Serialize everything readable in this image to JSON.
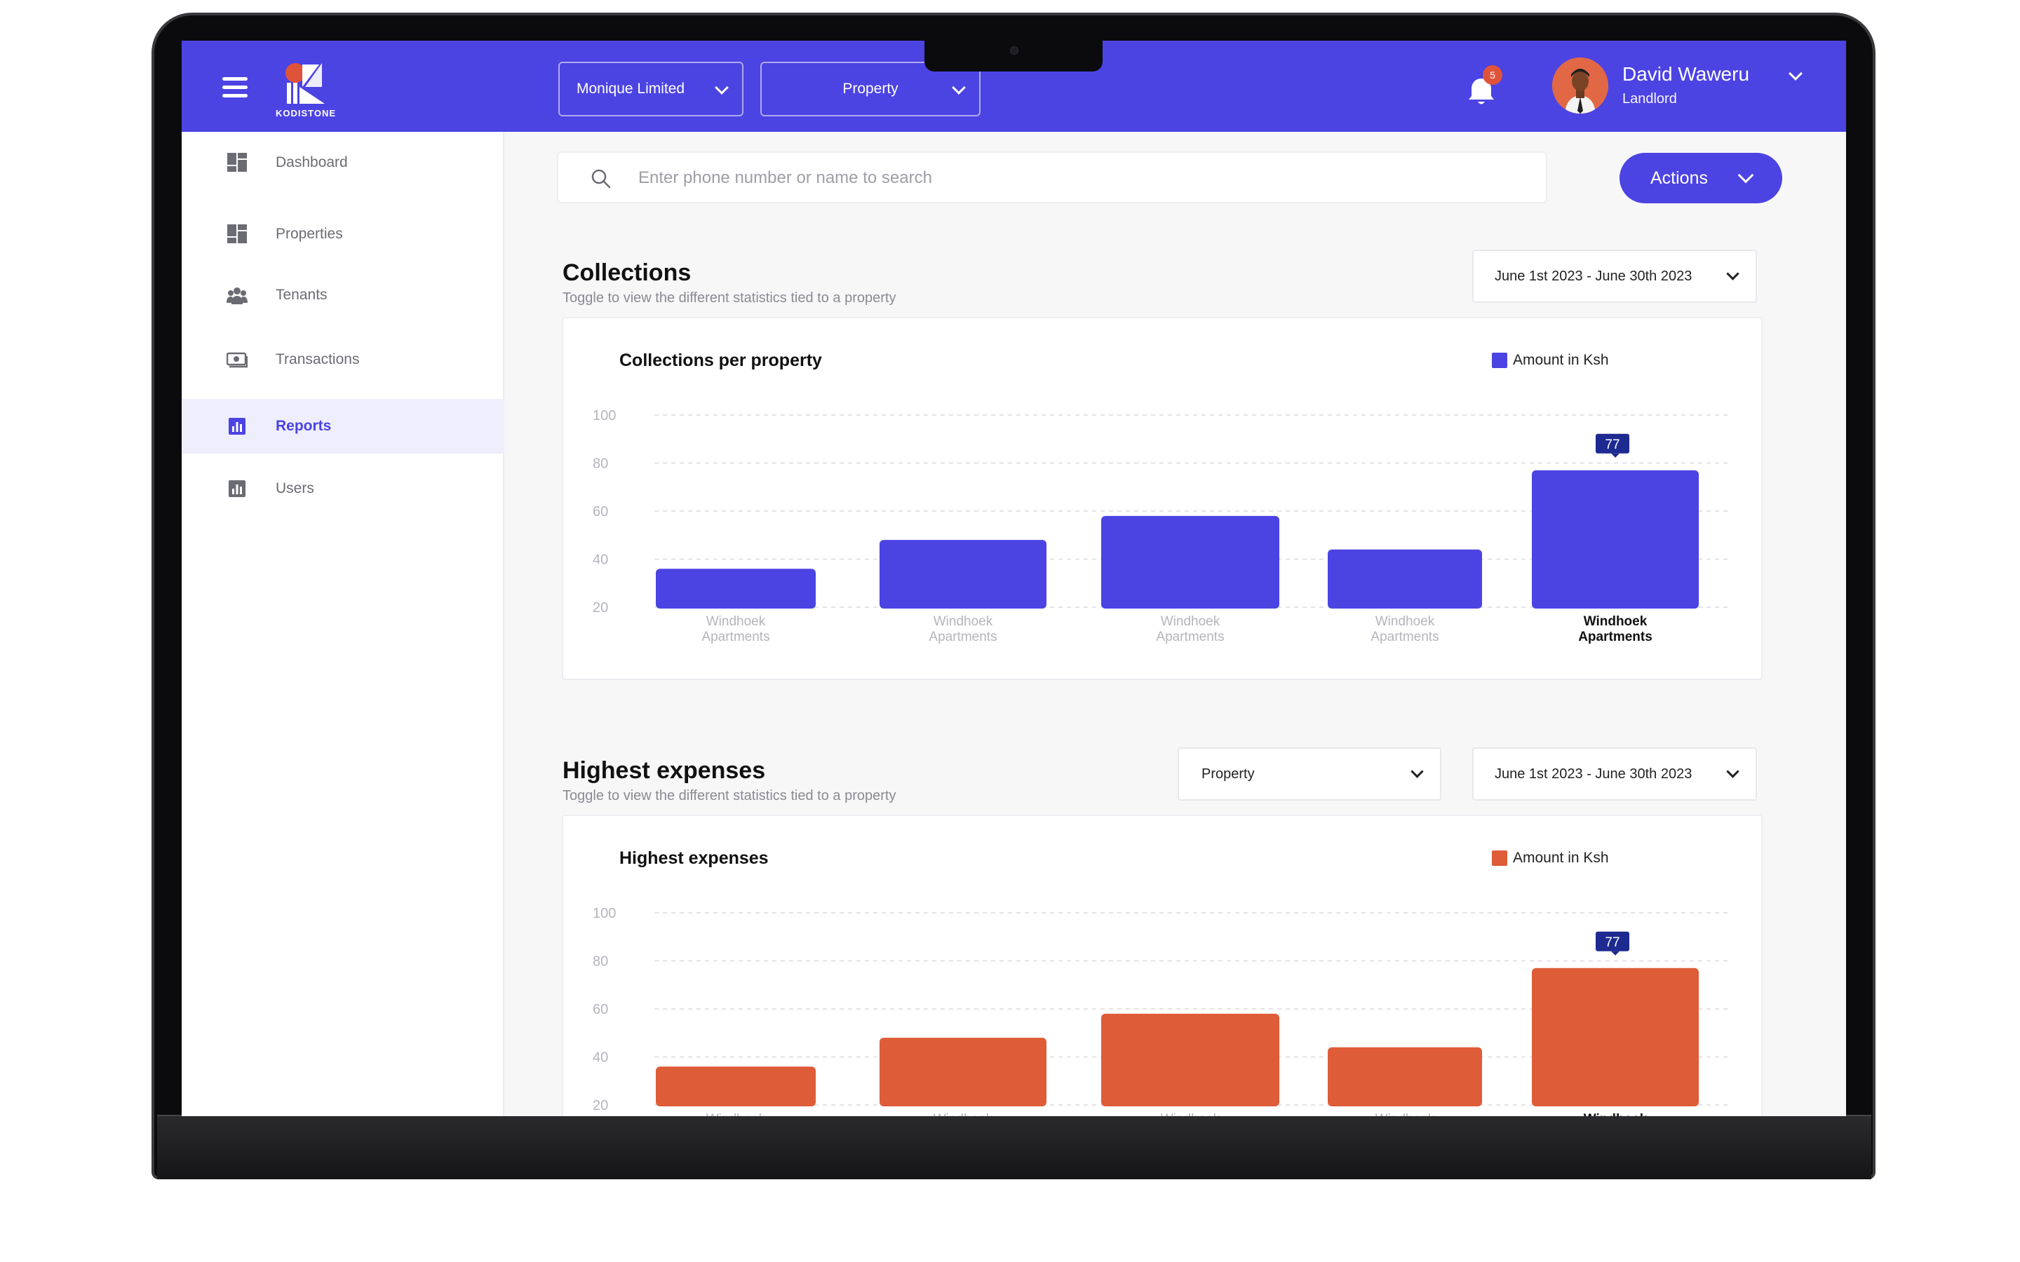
{
  "header": {
    "app_name": "KODISTONE",
    "company_select": "Monique Limited",
    "property_select": "Property",
    "notifications_count": "5",
    "user_name": "David Waweru",
    "user_role": "Landlord"
  },
  "sidebar": {
    "items": [
      {
        "label": "Dashboard",
        "icon": "dashboard-icon"
      },
      {
        "label": "Properties",
        "icon": "dashboard-icon"
      },
      {
        "label": "Tenants",
        "icon": "users-group-icon"
      },
      {
        "label": "Transactions",
        "icon": "cash-icon"
      },
      {
        "label": "Reports",
        "icon": "bar-chart-icon",
        "active": true
      },
      {
        "label": "Users",
        "icon": "bar-chart-icon"
      }
    ]
  },
  "search": {
    "placeholder": "Enter phone number or name to search"
  },
  "actions_label": "Actions",
  "collections": {
    "title": "Collections",
    "subtitle": "Toggle to view the different statistics tied to a property",
    "date_range": "June 1st 2023 - June 30th 2023",
    "card_title": "Collections per property",
    "legend": "Amount in Ksh",
    "color": "#4c43e3"
  },
  "expenses": {
    "title": "Highest expenses",
    "subtitle": "Toggle to view the different statistics tied to a property",
    "property_select": "Property",
    "date_range": "June 1st 2023 - June 30th 2023",
    "card_title": "Highest expenses",
    "legend": "Amount in Ksh",
    "color": "#de5c38"
  },
  "chart_data": [
    {
      "type": "bar",
      "title": "Collections per property",
      "categories": [
        "Windhoek Apartments",
        "Windhoek Apartments",
        "Windhoek Apartments",
        "Windhoek Apartments",
        "Windhoek Apartments"
      ],
      "series": [
        {
          "name": "Amount in Ksh",
          "values": [
            36,
            48,
            58,
            44,
            77
          ]
        }
      ],
      "y_ticks": [
        100,
        80,
        60,
        40,
        20
      ],
      "ylim": [
        20,
        100
      ],
      "highlight_index": 4,
      "highlight_label": "77",
      "legend_position": "top-right",
      "grid": true
    },
    {
      "type": "bar",
      "title": "Highest expenses",
      "categories": [
        "Windhoek Apartments",
        "Windhoek Apartments",
        "Windhoek Apartments",
        "Windhoek Apartments",
        "Windhoek Apartments"
      ],
      "series": [
        {
          "name": "Amount in Ksh",
          "values": [
            36,
            48,
            58,
            44,
            77
          ]
        }
      ],
      "y_ticks": [
        100,
        80,
        60,
        40,
        20
      ],
      "ylim": [
        20,
        100
      ],
      "highlight_index": 4,
      "highlight_label": "77",
      "legend_position": "top-right",
      "grid": true
    }
  ]
}
